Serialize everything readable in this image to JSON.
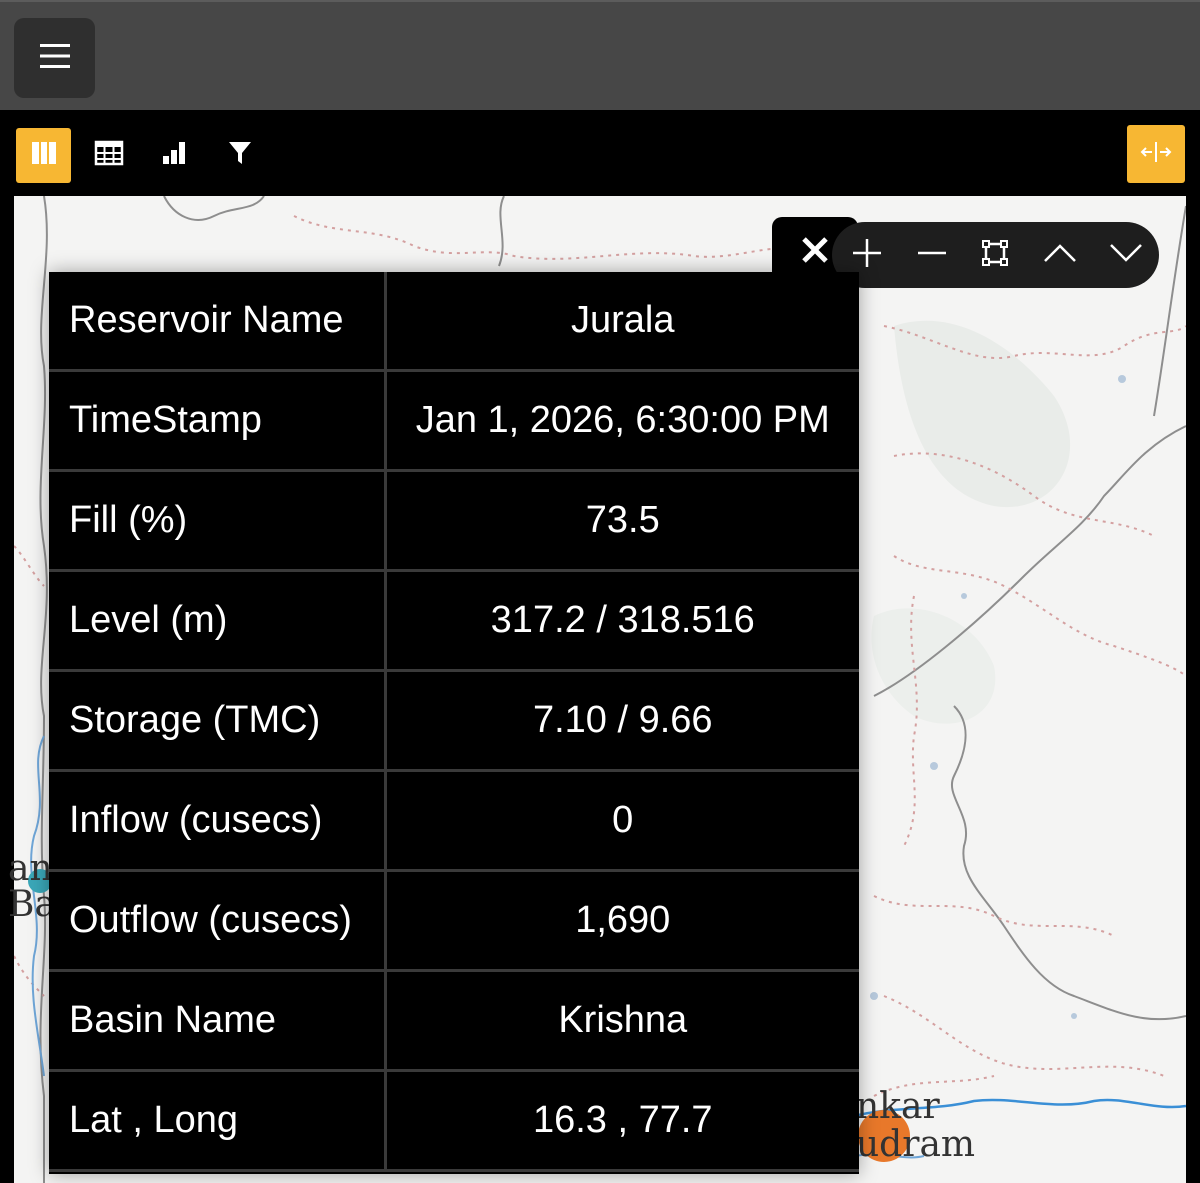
{
  "header": {
    "menu_icon": "hamburger-icon"
  },
  "toolbar": {
    "tools": [
      {
        "name": "map-view",
        "icon": "map-icon",
        "active": true
      },
      {
        "name": "table-view",
        "icon": "table-icon",
        "active": false
      },
      {
        "name": "chart-view",
        "icon": "bar-chart-icon",
        "active": false
      },
      {
        "name": "filter",
        "icon": "filter-icon",
        "active": false
      }
    ],
    "expand_icon": "horizontal-expand-icon",
    "accent": "#f7b733"
  },
  "popup": {
    "controls": [
      "close-icon",
      "zoom-in-icon",
      "zoom-out-icon",
      "fit-bounds-icon",
      "previous-icon",
      "next-icon"
    ],
    "rows": [
      {
        "label": "Reservoir Name",
        "value": "Jurala"
      },
      {
        "label": "TimeStamp",
        "value": "Jan 1, 2026, 6:30:00 PM"
      },
      {
        "label": "Fill (%)",
        "value": "73.5"
      },
      {
        "label": "Level (m)",
        "value": "317.2 / 318.516"
      },
      {
        "label": "Storage (TMC)",
        "value": "7.10 / 9.66"
      },
      {
        "label": "Inflow (cusecs)",
        "value": "0"
      },
      {
        "label": "Outflow (cusecs)",
        "value": "1,690"
      },
      {
        "label": "Basin Name",
        "value": "Krishna"
      },
      {
        "label": "Lat , Long",
        "value": "16.3 , 77.7"
      }
    ]
  },
  "map": {
    "labels": [
      {
        "name": "map-label-left-top",
        "text": "an"
      },
      {
        "name": "map-label-left-bottom",
        "text": "Ba"
      },
      {
        "name": "map-label-right-top",
        "text": "nkar"
      },
      {
        "name": "map-label-right-bottom",
        "text": "udram"
      }
    ],
    "marker_color": "#e8782a",
    "river_color": "#3a8fd6"
  }
}
